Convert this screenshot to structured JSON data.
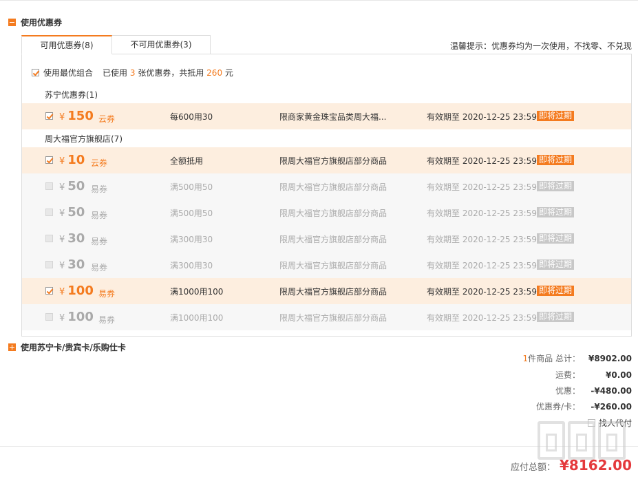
{
  "coupon_section": {
    "title": "使用优惠券",
    "tabs": [
      {
        "label": "可用优惠券(8)",
        "active": true
      },
      {
        "label": "不可用优惠券(3)",
        "active": false
      }
    ],
    "tip": "温馨提示：优惠券均为一次使用，不找零、不兑现",
    "best_combo": {
      "label": "使用最优组合",
      "used_prefix": "已使用",
      "used_count": "3",
      "used_mid": "张优惠券，共抵用",
      "used_amount": "260",
      "used_suffix": "元",
      "checked": true
    },
    "groups": [
      {
        "title": "苏宁优惠券(1)",
        "coupons": [
          {
            "amount": "150",
            "kind": "云券",
            "rule": "每600用30",
            "scope": "限商家黄金珠宝品类周大福...",
            "valid": "有效期至 2020-12-25 23:59",
            "badge": "即将过期",
            "state": "selected"
          }
        ]
      },
      {
        "title": "周大福官方旗舰店(7)",
        "coupons": [
          {
            "amount": "10",
            "kind": "云券",
            "rule": "全额抵用",
            "scope": "限周大福官方旗舰店部分商品",
            "valid": "有效期至 2020-12-25 23:59",
            "badge": "即将过期",
            "state": "selected"
          },
          {
            "amount": "50",
            "kind": "易券",
            "rule": "满500用50",
            "scope": "限周大福官方旗舰店部分商品",
            "valid": "有效期至 2020-12-25 23:59",
            "badge": "即将过期",
            "state": "disabled"
          },
          {
            "amount": "50",
            "kind": "易券",
            "rule": "满500用50",
            "scope": "限周大福官方旗舰店部分商品",
            "valid": "有效期至 2020-12-25 23:59",
            "badge": "即将过期",
            "state": "disabled"
          },
          {
            "amount": "30",
            "kind": "易券",
            "rule": "满300用30",
            "scope": "限周大福官方旗舰店部分商品",
            "valid": "有效期至 2020-12-25 23:59",
            "badge": "即将过期",
            "state": "disabled"
          },
          {
            "amount": "30",
            "kind": "易券",
            "rule": "满300用30",
            "scope": "限周大福官方旗舰店部分商品",
            "valid": "有效期至 2020-12-25 23:59",
            "badge": "即将过期",
            "state": "disabled"
          },
          {
            "amount": "100",
            "kind": "易券",
            "rule": "满1000用100",
            "scope": "限周大福官方旗舰店部分商品",
            "valid": "有效期至 2020-12-25 23:59",
            "badge": "即将过期",
            "state": "selected"
          },
          {
            "amount": "100",
            "kind": "易券",
            "rule": "满1000用100",
            "scope": "限周大福官方旗舰店部分商品",
            "valid": "有效期至 2020-12-25 23:59",
            "badge": "即将过期",
            "state": "disabled"
          }
        ]
      }
    ],
    "currency": "¥"
  },
  "card_section": {
    "title": "使用苏宁卡/贵宾卡/乐购仕卡"
  },
  "summary": {
    "items_count": "1",
    "items_label": "件商品 总计：",
    "total": "¥8902.00",
    "shipping_label": "运费：",
    "shipping": "¥0.00",
    "discount_label": "优惠：",
    "discount": "-¥480.00",
    "coupon_label": "优惠券/卡：",
    "coupon": "-¥260.00",
    "proxy_label": "找人代付",
    "pay_label": "应付总额：",
    "pay": "¥8162.00"
  },
  "colors": {
    "accent": "#f47b1f",
    "selected_bg": "#fdeedf",
    "disabled_bg": "#f7f7f7",
    "pay_red": "#e4393c"
  }
}
